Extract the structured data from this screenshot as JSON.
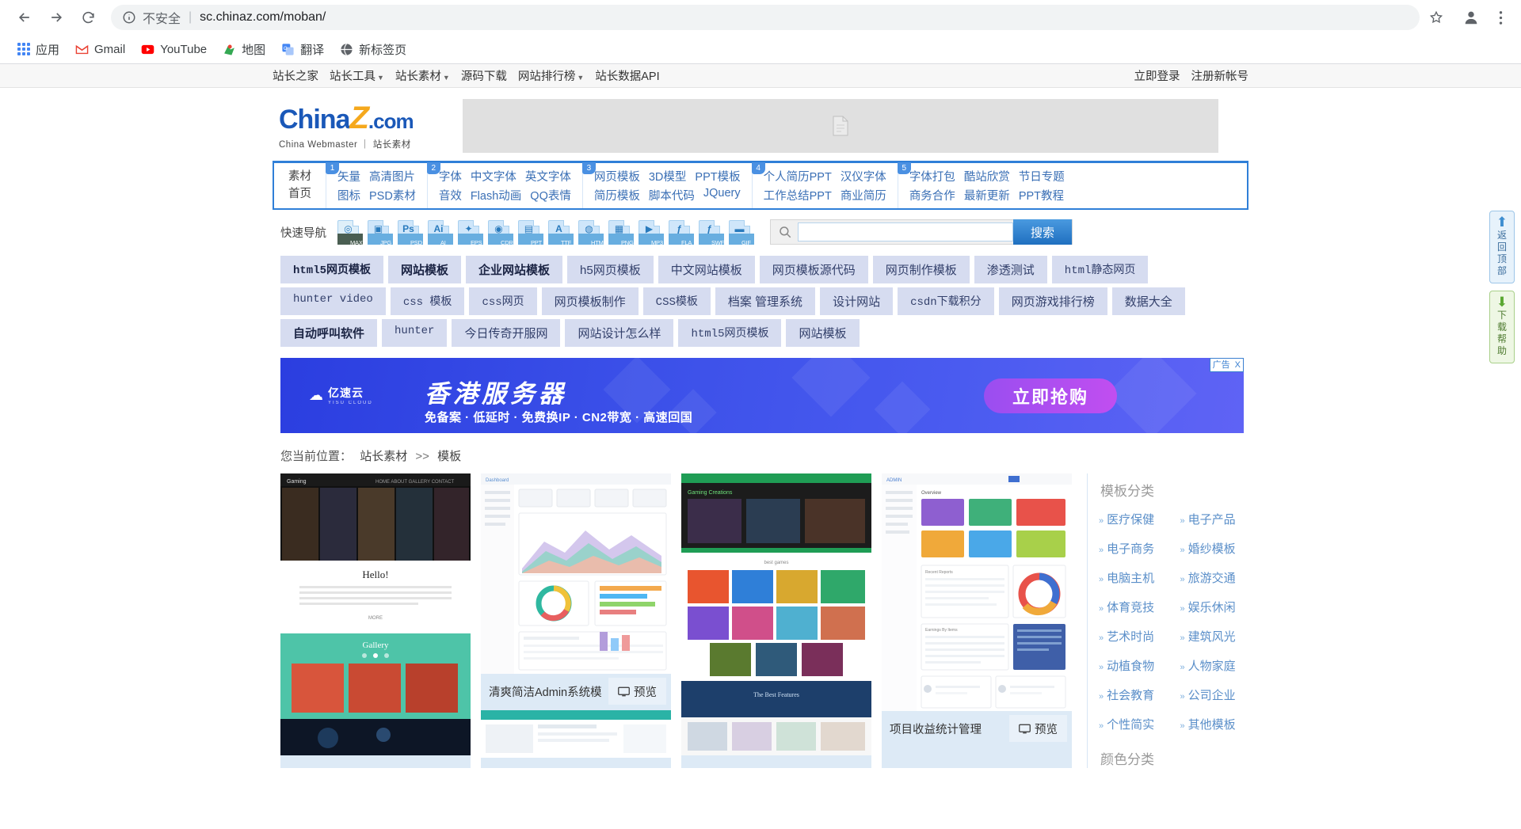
{
  "browser": {
    "security_label": "不安全",
    "url": "sc.chinaz.com/moban/",
    "bookmarks": [
      {
        "label": "应用",
        "icon": "apps-grid-icon"
      },
      {
        "label": "Gmail",
        "icon": "gmail-icon"
      },
      {
        "label": "YouTube",
        "icon": "youtube-icon"
      },
      {
        "label": "地图",
        "icon": "maps-icon"
      },
      {
        "label": "翻译",
        "icon": "translate-icon"
      },
      {
        "label": "新标签页",
        "icon": "globe-icon"
      }
    ]
  },
  "topbar": {
    "nav": [
      {
        "label": "站长之家",
        "caret": false
      },
      {
        "label": "站长工具",
        "caret": true
      },
      {
        "label": "站长素材",
        "caret": true
      },
      {
        "label": "源码下载",
        "caret": false
      },
      {
        "label": "网站排行榜",
        "caret": true
      },
      {
        "label": "站长数据API",
        "caret": false
      }
    ],
    "login": "立即登录",
    "register": "注册新帐号"
  },
  "logo": {
    "brand": "China",
    "z": "Z",
    "dotcom": ".com",
    "sub": "China Webmaster ｜ 站长素材"
  },
  "navbox": {
    "first": {
      "line1": "素材",
      "line2": "首页"
    },
    "groups": [
      {
        "badge": "1",
        "row1": [
          "矢量",
          "高清图片"
        ],
        "row2": [
          "图标",
          "PSD素材"
        ]
      },
      {
        "badge": "2",
        "row1": [
          "字体",
          "中文字体",
          "英文字体"
        ],
        "row2": [
          "音效",
          "Flash动画",
          "QQ表情"
        ]
      },
      {
        "badge": "3",
        "row1": [
          "网页模板",
          "3D模型",
          "PPT模板"
        ],
        "row2": [
          "简历模板",
          "脚本代码",
          "JQuery"
        ]
      },
      {
        "badge": "4",
        "row1": [
          "个人简历PPT",
          "汉仪字体"
        ],
        "row2": [
          "工作总结PPT",
          "商业简历"
        ]
      },
      {
        "badge": "5",
        "row1": [
          "字体打包",
          "酷站欣赏",
          "节日专题"
        ],
        "row2": [
          "商务合作",
          "最新更新",
          "PPT教程"
        ]
      }
    ]
  },
  "quicknav": {
    "label": "快速导航",
    "formats": [
      {
        "tag": "MAX",
        "glyph": "◎"
      },
      {
        "tag": "JPG",
        "glyph": "▣"
      },
      {
        "tag": "PSD",
        "glyph": "Ps"
      },
      {
        "tag": "AI",
        "glyph": "Ai"
      },
      {
        "tag": "EPS",
        "glyph": "✦"
      },
      {
        "tag": "CDR",
        "glyph": "◉"
      },
      {
        "tag": "PPT",
        "glyph": "▤"
      },
      {
        "tag": "TTF",
        "glyph": "A"
      },
      {
        "tag": "HTML",
        "glyph": "◍"
      },
      {
        "tag": "PNG",
        "glyph": "▦"
      },
      {
        "tag": "MP3",
        "glyph": "▶"
      },
      {
        "tag": "FLA",
        "glyph": "ƒ"
      },
      {
        "tag": "SWF",
        "glyph": "ƒ"
      },
      {
        "tag": "GIF",
        "glyph": "▬"
      }
    ],
    "search_value": "",
    "search_placeholder": "",
    "search_button": "搜索"
  },
  "tags": [
    {
      "text": "html5网页模板",
      "bold": true,
      "mono": true
    },
    {
      "text": "网站模板",
      "bold": true,
      "mono": false
    },
    {
      "text": "企业网站模板",
      "bold": true,
      "mono": false
    },
    {
      "text": "h5网页模板",
      "bold": false,
      "mono": false
    },
    {
      "text": "中文网站模板",
      "bold": false,
      "mono": false
    },
    {
      "text": "网页模板源代码",
      "bold": false,
      "mono": false
    },
    {
      "text": "网页制作模板",
      "bold": false,
      "mono": false
    },
    {
      "text": "渗透测试",
      "bold": false,
      "mono": false
    },
    {
      "text": "html静态网页",
      "bold": false,
      "mono": true
    },
    {
      "text": "hunter video",
      "bold": false,
      "mono": true
    },
    {
      "text": "css 模板",
      "bold": false,
      "mono": true
    },
    {
      "text": "css网页",
      "bold": false,
      "mono": true
    },
    {
      "text": "网页模板制作",
      "bold": false,
      "mono": false
    },
    {
      "text": "CSS模板",
      "bold": false,
      "mono": true
    },
    {
      "text": "档案 管理系统",
      "bold": false,
      "mono": false
    },
    {
      "text": "设计网站",
      "bold": false,
      "mono": false
    },
    {
      "text": "csdn下载积分",
      "bold": false,
      "mono": true
    },
    {
      "text": "网页游戏排行榜",
      "bold": false,
      "mono": false
    },
    {
      "text": "数据大全",
      "bold": false,
      "mono": false
    },
    {
      "text": "自动呼叫软件",
      "bold": true,
      "mono": false
    },
    {
      "text": "hunter",
      "bold": false,
      "mono": true
    },
    {
      "text": "今日传奇开服网",
      "bold": false,
      "mono": false
    },
    {
      "text": "网站设计怎么样",
      "bold": false,
      "mono": false
    },
    {
      "text": "html5网页模板",
      "bold": false,
      "mono": true
    },
    {
      "text": "网站模板",
      "bold": false,
      "mono": false
    }
  ],
  "ad": {
    "logo_name": "亿速云",
    "logo_sub": "YISU CLOUD",
    "title": "香港服务器",
    "subtitle": "免备案 · 低延时 · 免费换IP · CN2带宽 · 高速回国",
    "cta": "立即抢购",
    "ad_mark": "广告",
    "close": "X"
  },
  "breadcrumb": {
    "prefix": "您当前位置：",
    "root": "站长素材",
    "sep": ">>",
    "current": "模板"
  },
  "cards": [
    {
      "title": "",
      "preview": "",
      "type": "gaming-dark"
    },
    {
      "title": "清爽简洁Admin系统模",
      "preview": "预览",
      "type": "admin-dashboard"
    },
    {
      "title": "",
      "preview": "",
      "type": "gaming-creations"
    },
    {
      "title": "项目收益统计管理",
      "preview": "预览",
      "type": "analytics-dashboard"
    },
    {
      "title": "",
      "preview": "",
      "type": "row2-a"
    },
    {
      "title": "",
      "preview": "",
      "type": "row2-b"
    }
  ],
  "sidebar": {
    "title": "模板分类",
    "categories": [
      "医疗保健",
      "电子产品",
      "电子商务",
      "婚纱模板",
      "电脑主机",
      "旅游交通",
      "体育竞技",
      "娱乐休闲",
      "艺术时尚",
      "建筑风光",
      "动植食物",
      "人物家庭",
      "社会教育",
      "公司企业",
      "个性简实",
      "其他模板"
    ],
    "title2": "颜色分类"
  },
  "float_buttons": [
    {
      "name": "back-to-top",
      "icon": "up-arrow-icon",
      "chars": [
        "返",
        "回",
        "顶",
        "部"
      ]
    },
    {
      "name": "download-help",
      "icon": "download-icon",
      "chars": [
        "下",
        "载",
        "帮",
        "助"
      ]
    }
  ],
  "colors": {
    "brand_blue": "#1a58b8",
    "accent_orange": "#f5a81c",
    "nav_border": "#2f7fd8",
    "tag_bg": "#d6dcf0",
    "card_bg": "#ddeaf6"
  }
}
